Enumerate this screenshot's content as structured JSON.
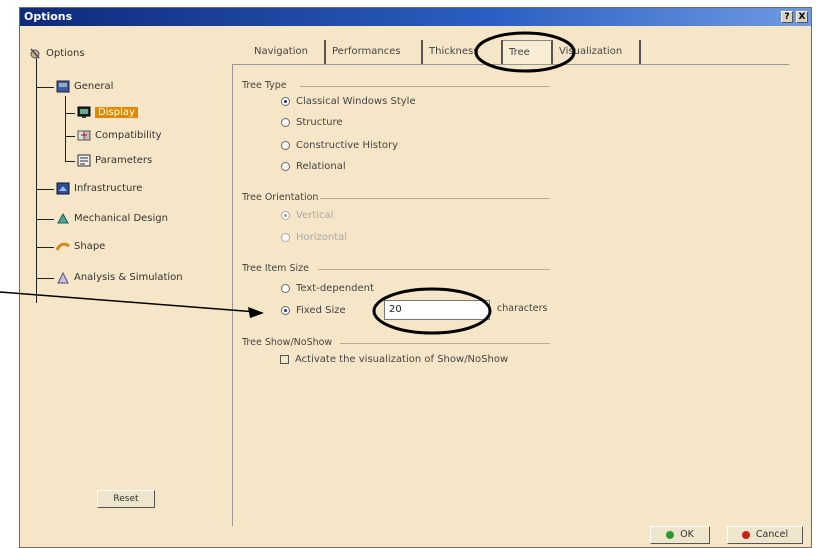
{
  "window": {
    "title": "Options",
    "help_label": "?",
    "close_label": "X"
  },
  "tree": {
    "items": [
      {
        "label": "Options",
        "icon": "options-icon"
      },
      {
        "label": "General",
        "icon": "general-icon"
      },
      {
        "label": "Display",
        "icon": "display-icon",
        "selected": true
      },
      {
        "label": "Compatibility",
        "icon": "compatibility-icon"
      },
      {
        "label": "Parameters",
        "icon": "parameters-icon"
      },
      {
        "label": "Infrastructure",
        "icon": "infrastructure-icon"
      },
      {
        "label": "Mechanical Design",
        "icon": "mechanical-design-icon"
      },
      {
        "label": "Shape",
        "icon": "shape-icon"
      },
      {
        "label": "Analysis & Simulation",
        "icon": "analysis-icon"
      }
    ],
    "reset_label": "Reset"
  },
  "tabs": [
    {
      "label": "Navigation"
    },
    {
      "label": "Performances"
    },
    {
      "label": "Thickness"
    },
    {
      "label": "Tree",
      "active": true
    },
    {
      "label": "Visualization"
    }
  ],
  "tree_type": {
    "title": "Tree Type",
    "options": [
      "Classical Windows Style",
      "Structure",
      "Constructive History",
      "Relational"
    ],
    "selected": "Classical Windows Style"
  },
  "tree_orientation": {
    "title": "Tree Orientation",
    "options": [
      "Vertical",
      "Horizontal"
    ],
    "selected": "Vertical",
    "disabled": true
  },
  "tree_item_size": {
    "title": "Tree Item Size",
    "options": [
      "Text-dependent",
      "Fixed Size"
    ],
    "selected": "Fixed Size",
    "value": "20",
    "unit_label": "characters"
  },
  "tree_show": {
    "title": "Tree Show/NoShow",
    "checkbox_label": "Activate the visualization of Show/NoShow",
    "checked": false
  },
  "footer": {
    "ok_label": "OK",
    "cancel_label": "Cancel"
  }
}
